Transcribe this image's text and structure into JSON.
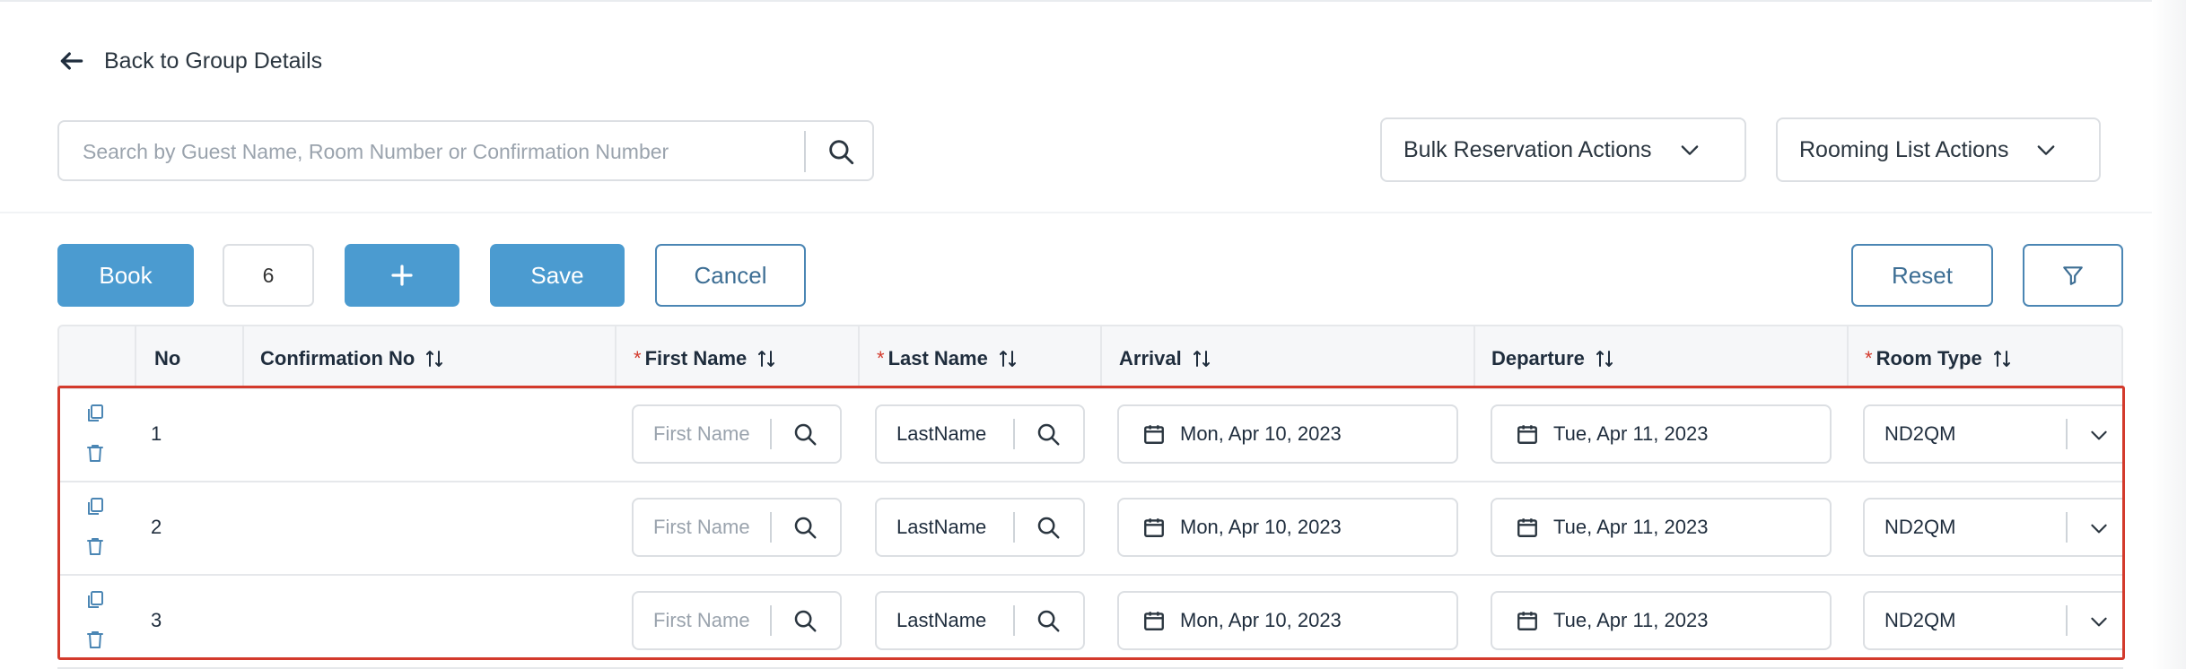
{
  "nav": {
    "back_label": "Back to Group Details"
  },
  "search": {
    "placeholder": "Search by Guest Name, Room Number or Confirmation Number",
    "value": ""
  },
  "actions": {
    "bulk_label": "Bulk Reservation Actions",
    "rooming_label": "Rooming List Actions"
  },
  "toolbar": {
    "book_label": "Book",
    "quantity": "6",
    "add_label": "+",
    "save_label": "Save",
    "cancel_label": "Cancel",
    "reset_label": "Reset"
  },
  "table": {
    "columns": {
      "no": "No",
      "confirmation": "Confirmation No",
      "first_name": "First Name",
      "last_name": "Last Name",
      "arrival": "Arrival",
      "departure": "Departure",
      "room_type": "Room Type"
    },
    "required_marker": "*",
    "rows": [
      {
        "no": "1",
        "confirmation": "",
        "first_name_placeholder": "First Name",
        "first_name": "",
        "last_name": "LastName",
        "arrival": "Mon, Apr 10, 2023",
        "departure": "Tue, Apr 11, 2023",
        "room_type": "ND2QM"
      },
      {
        "no": "2",
        "confirmation": "",
        "first_name_placeholder": "First Name",
        "first_name": "",
        "last_name": "LastName",
        "arrival": "Mon, Apr 10, 2023",
        "departure": "Tue, Apr 11, 2023",
        "room_type": "ND2QM"
      },
      {
        "no": "3",
        "confirmation": "",
        "first_name_placeholder": "First Name",
        "first_name": "",
        "last_name": "LastName",
        "arrival": "Mon, Apr 10, 2023",
        "departure": "Tue, Apr 11, 2023",
        "room_type": "ND2QM"
      }
    ]
  },
  "icons": {
    "back": "arrow-left-icon",
    "search": "search-icon",
    "chevron": "chevron-down-icon",
    "copy": "copy-icon",
    "delete": "trash-icon",
    "calendar": "calendar-icon",
    "sort": "sort-icon",
    "filter": "filter-icon"
  },
  "colors": {
    "primary": "#4b9bd0",
    "outline": "#4b86b4",
    "required": "#d33a2c",
    "highlight": "#d33a2c"
  }
}
